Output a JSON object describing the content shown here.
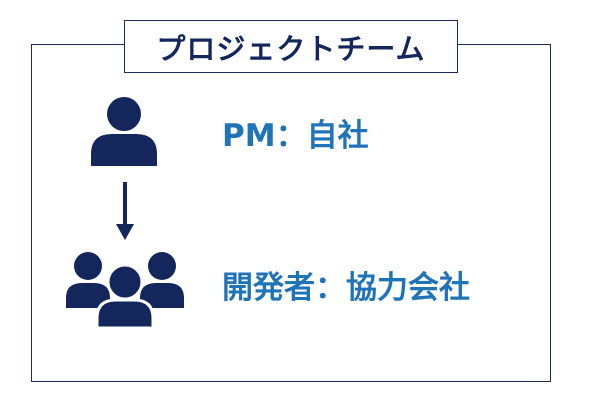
{
  "team": {
    "title": "プロジェクトチーム"
  },
  "roles": [
    {
      "label": "PM：自社",
      "icon": "person-icon"
    },
    {
      "label": "開発者：協力会社",
      "icon": "group-icon"
    }
  ],
  "connector": {
    "icon": "arrow-down-icon"
  },
  "colors": {
    "navy": "#13275c",
    "accent_blue": "#1f73b7",
    "frame": "#1a2b5c"
  }
}
